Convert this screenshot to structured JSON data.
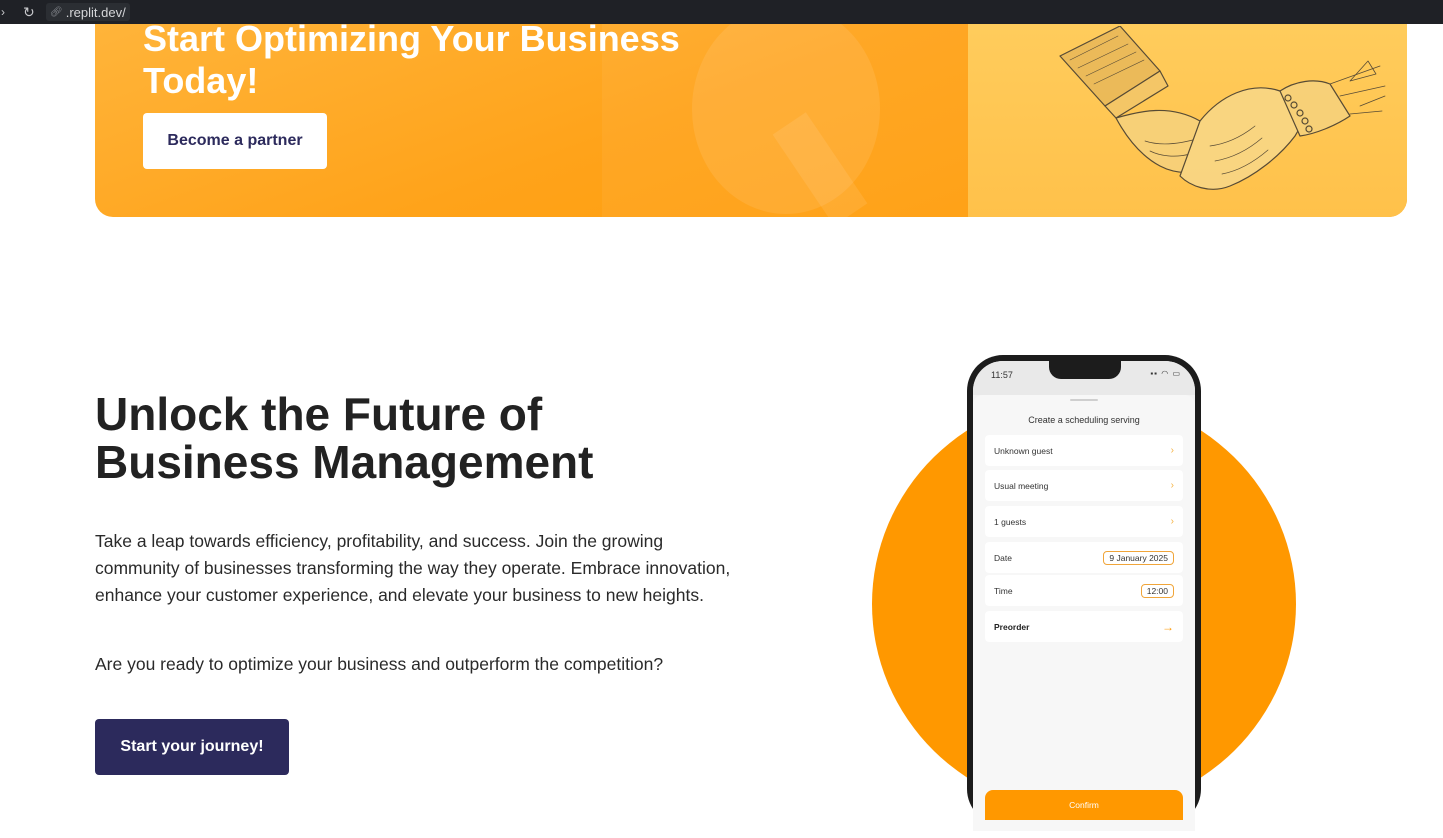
{
  "browser": {
    "url": ".replit.dev/"
  },
  "banner": {
    "title": "Start Optimizing Your Business Today!",
    "partner_button": "Become a partner"
  },
  "hero": {
    "title": "Unlock the Future of Business Management",
    "description": "Take a leap towards efficiency, profitability, and success. Join the growing community of businesses transforming the way they operate. Embrace innovation, enhance your customer experience, and elevate your business to new heights.",
    "question": "Are you ready to optimize your business and outperform the competition?",
    "journey_button": "Start your journey!"
  },
  "phone": {
    "time": "11:57",
    "sheet_title": "Create a scheduling serving",
    "rows": [
      {
        "label": "Unknown guest"
      },
      {
        "label": "Usual meeting"
      },
      {
        "label": "1 guests"
      },
      {
        "label": "Date",
        "value": "9 January 2025"
      },
      {
        "label": "Time",
        "value": "12:00"
      },
      {
        "label": "Preorder"
      }
    ],
    "confirm": "Confirm"
  },
  "colors": {
    "accent_orange": "#ff9800",
    "navy": "#2c2a5c",
    "banner_yellow": "#ffc14a"
  }
}
